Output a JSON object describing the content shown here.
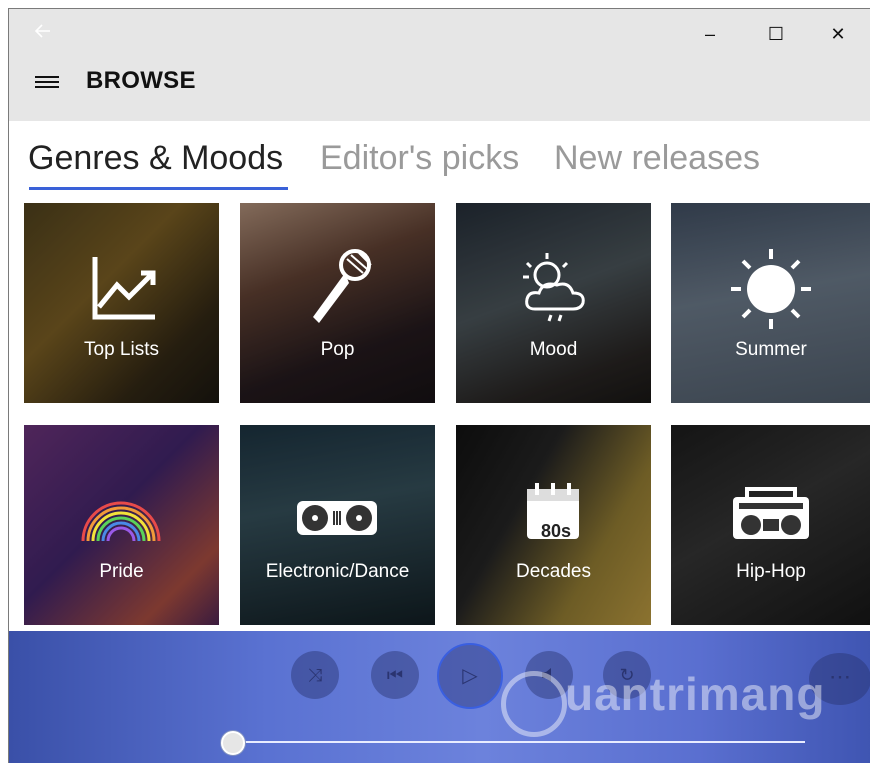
{
  "window": {
    "back_icon": "arrow-left-icon",
    "minimize": "–",
    "maximize": "☐",
    "close": "✕"
  },
  "header": {
    "title": "BROWSE"
  },
  "tabs": [
    {
      "label": "Genres & Moods",
      "active": true
    },
    {
      "label": "Editor's picks",
      "active": false
    },
    {
      "label": "New releases",
      "active": false
    }
  ],
  "tiles": [
    {
      "label": "Top Lists",
      "icon": "trending-chart-icon"
    },
    {
      "label": "Pop",
      "icon": "microphone-icon"
    },
    {
      "label": "Mood",
      "icon": "weather-icon"
    },
    {
      "label": "Summer",
      "icon": "sun-icon"
    },
    {
      "label": "Pride",
      "icon": "rainbow-icon"
    },
    {
      "label": "Electronic/Dance",
      "icon": "turntable-icon"
    },
    {
      "label": "Decades",
      "icon": "calendar-80s-icon"
    },
    {
      "label": "Hip-Hop",
      "icon": "boombox-icon"
    }
  ],
  "decades_badge": "80s",
  "player": {
    "shuffle_icon": "⤨",
    "previous_icon": "⏮",
    "play_icon": "▷",
    "repeat_icon": "↻",
    "more_icon": "⋯",
    "progress": 0.0
  },
  "watermark": "uantrimang",
  "colors": {
    "accent": "#3a61d8",
    "player_bg": "#5a72d2",
    "titlebar_bg": "#e6e6e6"
  }
}
